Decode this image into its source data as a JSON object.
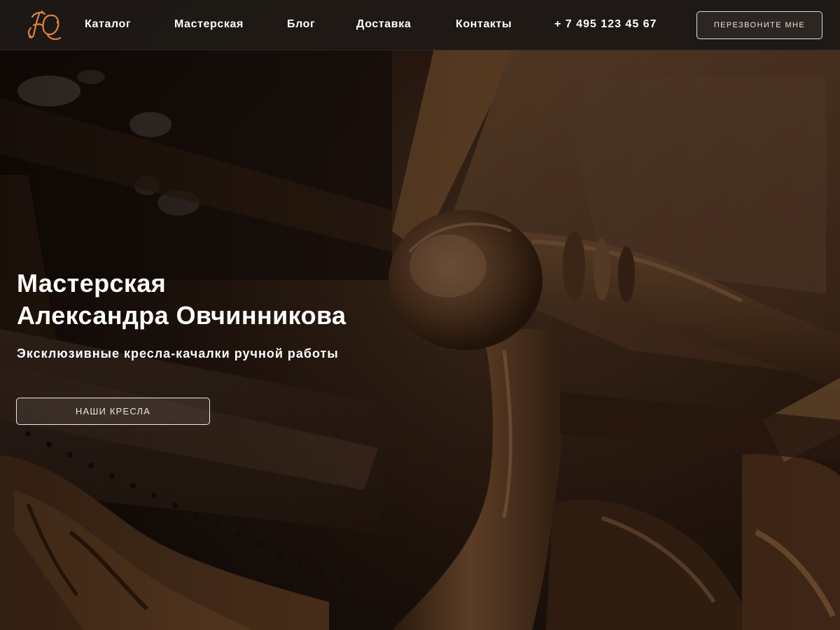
{
  "header": {
    "logo": {
      "icon": "monogram-logo",
      "color": "#e0843e"
    },
    "nav": [
      {
        "label": "Каталог"
      },
      {
        "label": "Мастерская"
      },
      {
        "label": "Блог"
      },
      {
        "label": "Доставка"
      },
      {
        "label": "Контакты"
      }
    ],
    "phone": "+ 7 495 123 45 67",
    "callback_button": "ПЕРЕЗВОНИТЕ МНЕ"
  },
  "hero": {
    "title_line1": "Мастерская",
    "title_line2": "Александра Овчинникова",
    "subtitle": "Эксклюзивные кресла-качалки ручной работы",
    "cta_button": "НАШИ КРЕСЛА",
    "background": "rocking-chair-photo"
  },
  "colors": {
    "header_bg": "#1e1a17",
    "accent": "#e0843e",
    "text": "#ffffff"
  }
}
